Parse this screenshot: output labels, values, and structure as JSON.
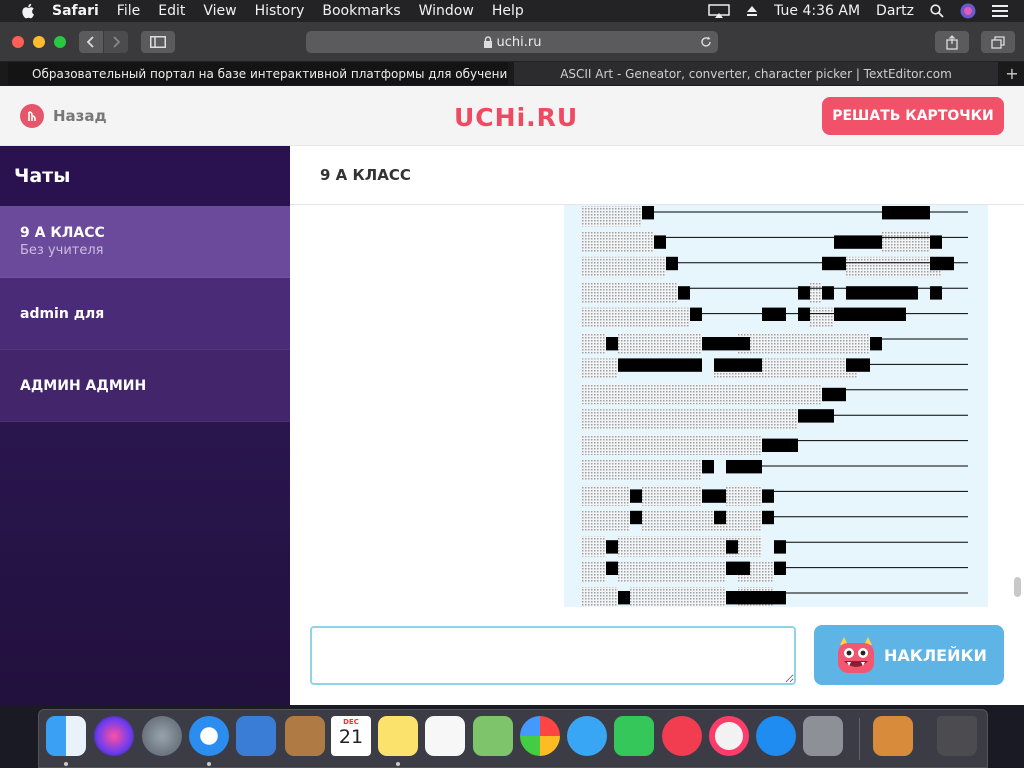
{
  "menubar": {
    "app": "Safari",
    "menus": [
      "File",
      "Edit",
      "View",
      "History",
      "Bookmarks",
      "Window",
      "Help"
    ],
    "clock": "Tue 4:36 AM",
    "user": "Dartz"
  },
  "browser": {
    "url": "uchi.ru",
    "tabs": [
      {
        "title": "Образовательный портал на базе интерактивной платформы для обучения детей"
      },
      {
        "title": "ASCII Art - Geneator, converter, character picker | TextEditor.com"
      }
    ],
    "new_tab_label": "+"
  },
  "header": {
    "back_label": "Назад",
    "logo": "UCHi.RU",
    "solve_button": "РЕШАТЬ КАРТОЧКИ"
  },
  "sidebar": {
    "title": "Чаты",
    "items": [
      {
        "name": "9 А КЛАСС",
        "subtitle": "Без учителя",
        "active": true
      },
      {
        "name": "admin для",
        "subtitle": "",
        "active": false
      },
      {
        "name": "АДМИН АДМИН",
        "subtitle": "",
        "active": false
      }
    ]
  },
  "chat": {
    "title": "9 А КЛАСС",
    "message_input_value": "",
    "stickers_button": "НАКЛЕЙКИ"
  },
  "colors": {
    "brand": "#ee4b62",
    "solve_button": "#f2516a",
    "sidebar_active": "#6b4a9c",
    "stickers_button": "#5fb4e6",
    "ascii_background": "#e7f6fd"
  },
  "dock": {
    "apps": [
      "finder-icon",
      "siri-icon",
      "launchpad-icon",
      "safari-icon",
      "mail-icon",
      "contacts-icon",
      "calendar-icon",
      "notes-icon",
      "reminders-icon",
      "maps-icon",
      "photos-icon",
      "messages-icon",
      "facetime-icon",
      "news-icon",
      "music-icon",
      "app-store-icon",
      "system-preferences-icon",
      "calculator-icon",
      "trash-icon"
    ],
    "calendar_month": "DEC",
    "calendar_day": "21"
  }
}
